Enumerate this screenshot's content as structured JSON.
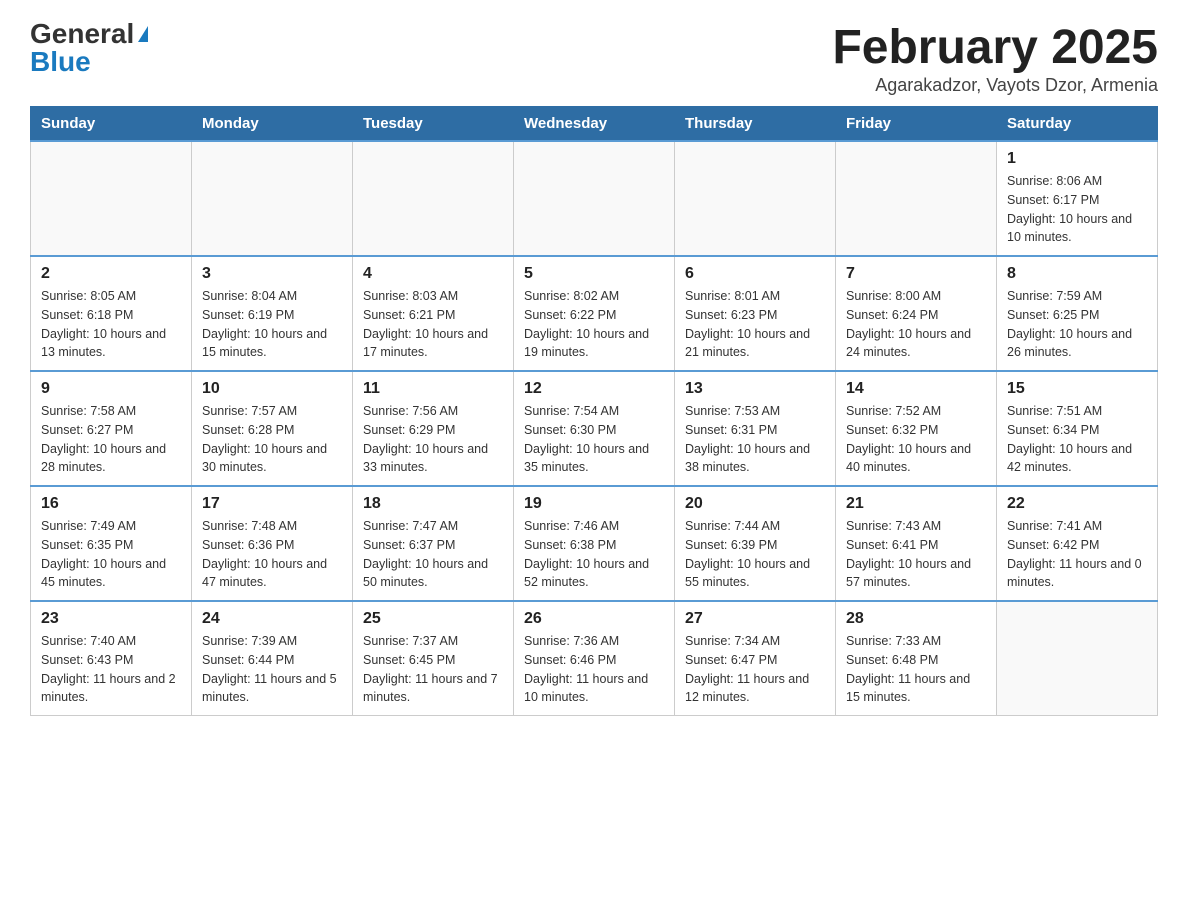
{
  "header": {
    "logo_general": "General",
    "logo_blue": "Blue",
    "month_year": "February 2025",
    "location": "Agarakadzor, Vayots Dzor, Armenia"
  },
  "days_of_week": [
    "Sunday",
    "Monday",
    "Tuesday",
    "Wednesday",
    "Thursday",
    "Friday",
    "Saturday"
  ],
  "weeks": [
    [
      {
        "day": "",
        "info": ""
      },
      {
        "day": "",
        "info": ""
      },
      {
        "day": "",
        "info": ""
      },
      {
        "day": "",
        "info": ""
      },
      {
        "day": "",
        "info": ""
      },
      {
        "day": "",
        "info": ""
      },
      {
        "day": "1",
        "info": "Sunrise: 8:06 AM\nSunset: 6:17 PM\nDaylight: 10 hours and 10 minutes."
      }
    ],
    [
      {
        "day": "2",
        "info": "Sunrise: 8:05 AM\nSunset: 6:18 PM\nDaylight: 10 hours and 13 minutes."
      },
      {
        "day": "3",
        "info": "Sunrise: 8:04 AM\nSunset: 6:19 PM\nDaylight: 10 hours and 15 minutes."
      },
      {
        "day": "4",
        "info": "Sunrise: 8:03 AM\nSunset: 6:21 PM\nDaylight: 10 hours and 17 minutes."
      },
      {
        "day": "5",
        "info": "Sunrise: 8:02 AM\nSunset: 6:22 PM\nDaylight: 10 hours and 19 minutes."
      },
      {
        "day": "6",
        "info": "Sunrise: 8:01 AM\nSunset: 6:23 PM\nDaylight: 10 hours and 21 minutes."
      },
      {
        "day": "7",
        "info": "Sunrise: 8:00 AM\nSunset: 6:24 PM\nDaylight: 10 hours and 24 minutes."
      },
      {
        "day": "8",
        "info": "Sunrise: 7:59 AM\nSunset: 6:25 PM\nDaylight: 10 hours and 26 minutes."
      }
    ],
    [
      {
        "day": "9",
        "info": "Sunrise: 7:58 AM\nSunset: 6:27 PM\nDaylight: 10 hours and 28 minutes."
      },
      {
        "day": "10",
        "info": "Sunrise: 7:57 AM\nSunset: 6:28 PM\nDaylight: 10 hours and 30 minutes."
      },
      {
        "day": "11",
        "info": "Sunrise: 7:56 AM\nSunset: 6:29 PM\nDaylight: 10 hours and 33 minutes."
      },
      {
        "day": "12",
        "info": "Sunrise: 7:54 AM\nSunset: 6:30 PM\nDaylight: 10 hours and 35 minutes."
      },
      {
        "day": "13",
        "info": "Sunrise: 7:53 AM\nSunset: 6:31 PM\nDaylight: 10 hours and 38 minutes."
      },
      {
        "day": "14",
        "info": "Sunrise: 7:52 AM\nSunset: 6:32 PM\nDaylight: 10 hours and 40 minutes."
      },
      {
        "day": "15",
        "info": "Sunrise: 7:51 AM\nSunset: 6:34 PM\nDaylight: 10 hours and 42 minutes."
      }
    ],
    [
      {
        "day": "16",
        "info": "Sunrise: 7:49 AM\nSunset: 6:35 PM\nDaylight: 10 hours and 45 minutes."
      },
      {
        "day": "17",
        "info": "Sunrise: 7:48 AM\nSunset: 6:36 PM\nDaylight: 10 hours and 47 minutes."
      },
      {
        "day": "18",
        "info": "Sunrise: 7:47 AM\nSunset: 6:37 PM\nDaylight: 10 hours and 50 minutes."
      },
      {
        "day": "19",
        "info": "Sunrise: 7:46 AM\nSunset: 6:38 PM\nDaylight: 10 hours and 52 minutes."
      },
      {
        "day": "20",
        "info": "Sunrise: 7:44 AM\nSunset: 6:39 PM\nDaylight: 10 hours and 55 minutes."
      },
      {
        "day": "21",
        "info": "Sunrise: 7:43 AM\nSunset: 6:41 PM\nDaylight: 10 hours and 57 minutes."
      },
      {
        "day": "22",
        "info": "Sunrise: 7:41 AM\nSunset: 6:42 PM\nDaylight: 11 hours and 0 minutes."
      }
    ],
    [
      {
        "day": "23",
        "info": "Sunrise: 7:40 AM\nSunset: 6:43 PM\nDaylight: 11 hours and 2 minutes."
      },
      {
        "day": "24",
        "info": "Sunrise: 7:39 AM\nSunset: 6:44 PM\nDaylight: 11 hours and 5 minutes."
      },
      {
        "day": "25",
        "info": "Sunrise: 7:37 AM\nSunset: 6:45 PM\nDaylight: 11 hours and 7 minutes."
      },
      {
        "day": "26",
        "info": "Sunrise: 7:36 AM\nSunset: 6:46 PM\nDaylight: 11 hours and 10 minutes."
      },
      {
        "day": "27",
        "info": "Sunrise: 7:34 AM\nSunset: 6:47 PM\nDaylight: 11 hours and 12 minutes."
      },
      {
        "day": "28",
        "info": "Sunrise: 7:33 AM\nSunset: 6:48 PM\nDaylight: 11 hours and 15 minutes."
      },
      {
        "day": "",
        "info": ""
      }
    ]
  ]
}
